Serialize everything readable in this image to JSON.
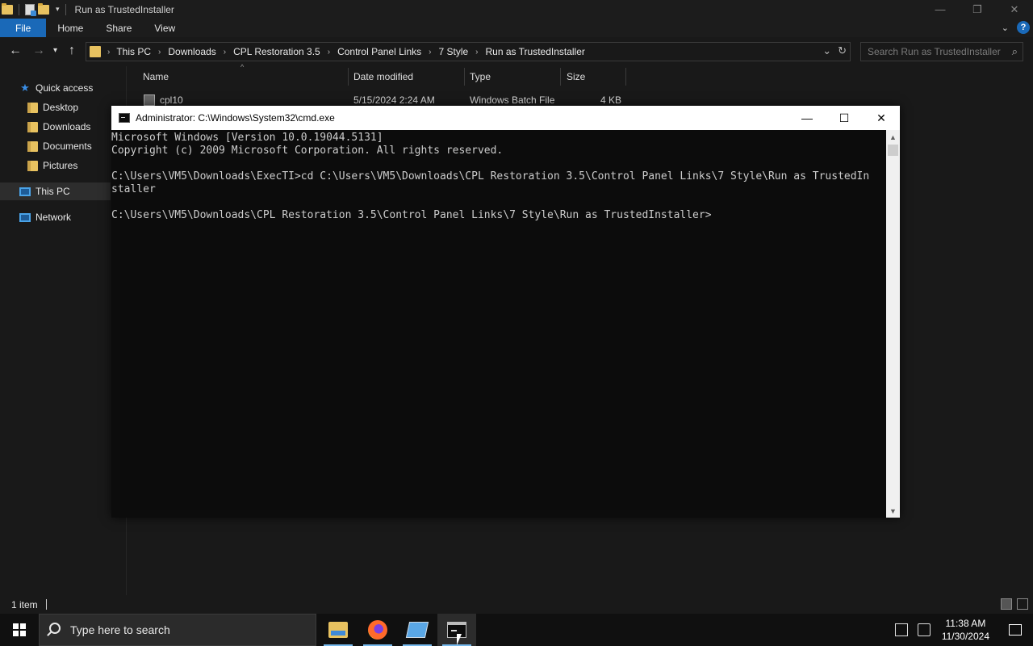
{
  "explorer": {
    "window_title": "Run as TrustedInstaller",
    "window_controls": [
      "—",
      "❐",
      "✕"
    ],
    "ribbon_tabs": [
      "File",
      "Home",
      "Share",
      "View"
    ],
    "help_label": "?",
    "address": {
      "crumbs": [
        "This PC",
        "Downloads",
        "CPL Restoration 3.5",
        "Control Panel Links",
        "7 Style",
        "Run as TrustedInstaller"
      ]
    },
    "search_placeholder": "Search Run as TrustedInstaller",
    "sidebar": {
      "items": [
        {
          "label": "Quick access",
          "icon": "star-icon"
        },
        {
          "label": "Desktop",
          "icon": "folder-icon"
        },
        {
          "label": "Downloads",
          "icon": "folder-icon"
        },
        {
          "label": "Documents",
          "icon": "folder-icon"
        },
        {
          "label": "Pictures",
          "icon": "folder-icon"
        },
        {
          "label": "This PC",
          "icon": "computer-icon",
          "selected": true
        },
        {
          "label": "Network",
          "icon": "network-icon"
        }
      ]
    },
    "columns": [
      "Name",
      "Date modified",
      "Type",
      "Size"
    ],
    "files": [
      {
        "name": "cpl10",
        "modified": "5/15/2024 2:24 AM",
        "type": "Windows Batch File",
        "size": "4 KB"
      }
    ],
    "status": "1 item"
  },
  "cmd": {
    "title": "Administrator: C:\\Windows\\System32\\cmd.exe",
    "controls": [
      "—",
      "☐",
      "✕"
    ],
    "lines": [
      "Microsoft Windows [Version 10.0.19044.5131]",
      "Copyright (c) 2009 Microsoft Corporation. All rights reserved.",
      "",
      "C:\\Users\\VM5\\Downloads\\ExecTI>cd C:\\Users\\VM5\\Downloads\\CPL Restoration 3.5\\Control Panel Links\\7 Style\\Run as TrustedIn",
      "staller",
      "",
      "C:\\Users\\VM5\\Downloads\\CPL Restoration 3.5\\Control Panel Links\\7 Style\\Run as TrustedInstaller>"
    ]
  },
  "taskbar": {
    "search_placeholder": "Type here to search",
    "apps": [
      "file-explorer",
      "firefox",
      "control-panel",
      "command-prompt"
    ],
    "active_app": "command-prompt",
    "time": "11:38 AM",
    "date": "11/30/2024"
  }
}
